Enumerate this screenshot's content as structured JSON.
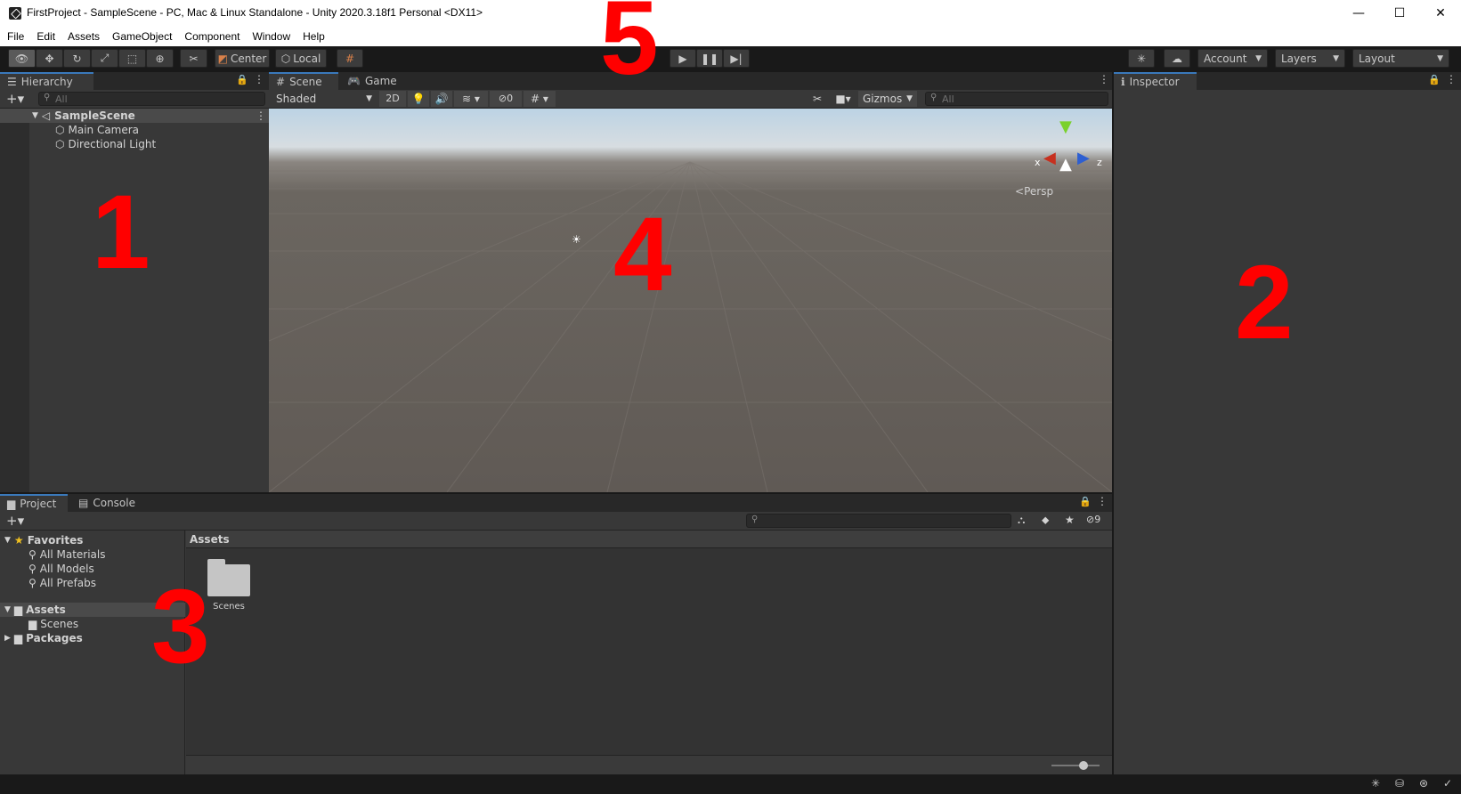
{
  "window": {
    "title": "FirstProject - SampleScene - PC, Mac & Linux Standalone - Unity 2020.3.18f1 Personal <DX11>",
    "controls": [
      "—",
      "☐",
      "✕"
    ]
  },
  "menu": [
    "File",
    "Edit",
    "Assets",
    "GameObject",
    "Component",
    "Window",
    "Help"
  ],
  "toolbar": {
    "pivot_label": "Center",
    "space_label": "Local",
    "account_label": "Account",
    "layers_label": "Layers",
    "layout_label": "Layout"
  },
  "hierarchy": {
    "tab": "Hierarchy",
    "search_placeholder": "All",
    "scene": "SampleScene",
    "objects": [
      "Main Camera",
      "Directional Light"
    ]
  },
  "scene_view": {
    "tabs": [
      "Scene",
      "Game"
    ],
    "shading": "Shaded",
    "mode_2d": "2D",
    "hidden_count": "0",
    "gizmos_label": "Gizmos",
    "search_placeholder": "All",
    "projection": "Persp",
    "axis_x": "x",
    "axis_z": "z"
  },
  "inspector": {
    "tab": "Inspector"
  },
  "project": {
    "tabs": [
      "Project",
      "Console"
    ],
    "hidden_count": "9",
    "favorites_label": "Favorites",
    "favorites": [
      "All Materials",
      "All Models",
      "All Prefabs"
    ],
    "assets_label": "Assets",
    "asset_children": [
      "Scenes"
    ],
    "packages_label": "Packages",
    "breadcrumb": "Assets",
    "folder_items": [
      "Scenes"
    ]
  },
  "annotations": [
    "1",
    "2",
    "3",
    "4",
    "5"
  ],
  "colors": {
    "accent_tab": "#3a79bb",
    "annotation": "#ff0000",
    "panel_bg": "#383838",
    "tab_bg": "#282828"
  }
}
